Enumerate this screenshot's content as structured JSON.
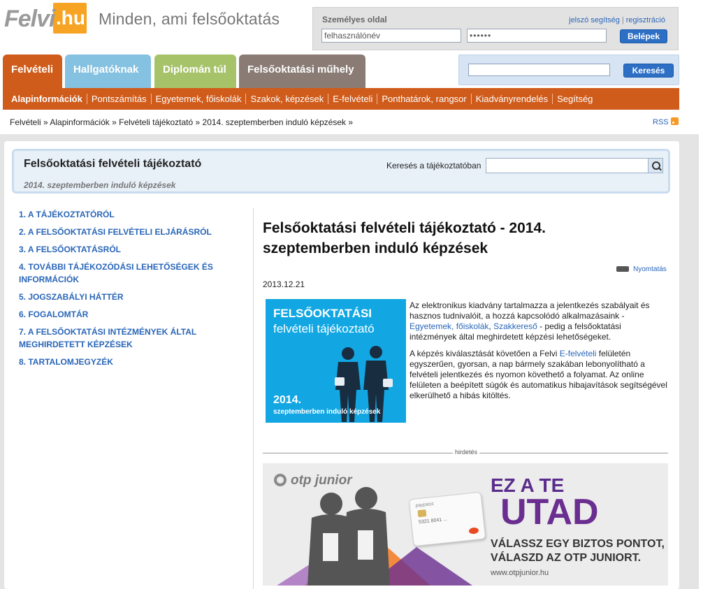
{
  "header": {
    "logo_main": "Felvi",
    "logo_accent": ".hu",
    "tagline": "Minden, ami felsőoktatás"
  },
  "login": {
    "title": "Személyes oldal",
    "forgot": "jelszó segítség",
    "register": "regisztráció",
    "separator": "|",
    "username_value": "felhasználónév",
    "password_value": "••••••",
    "submit": "Belépek"
  },
  "tabs": [
    {
      "label": "Felvételi",
      "color": "#d05c1b"
    },
    {
      "label": "Hallgatóknak",
      "color": "#85c1e0"
    },
    {
      "label": "Diplomán túl",
      "color": "#a7c36a"
    },
    {
      "label": "Felsőoktatási műhely",
      "color": "#8a7c75"
    }
  ],
  "search": {
    "value": "",
    "button": "Keresés"
  },
  "subnav": [
    "Alapinformációk",
    "Pontszámítás",
    "Egyetemek, főiskolák",
    "Szakok, képzések",
    "E-felvételi",
    "Ponthatárok, rangsor",
    "Kiadványrendelés",
    "Segítség"
  ],
  "breadcrumb": [
    "Felvételi »",
    "Alapinformációk »",
    "Felvételi tájékoztató »",
    "2014. szeptemberben induló képzések »"
  ],
  "rss": "RSS",
  "infobox": {
    "title": "Felsőoktatási felvételi tájékoztató",
    "subtitle": "2014. szeptemberben induló képzések",
    "search_label": "Keresés a tájékoztatóban",
    "search_value": ""
  },
  "toc": [
    "1. A TÁJÉKOZTATÓRÓL",
    "2. A FELSŐOKTATÁSI FELVÉTELI ELJÁRÁSRÓL",
    "3. A FELSŐOKTATÁSRÓL",
    "4. TOVÁBBI TÁJÉKOZÓDÁSI LEHETŐSÉGEK ÉS INFORMÁCIÓK",
    "5. JOGSZABÁLYI HÁTTÉR",
    "6. FOGALOMTÁR",
    "7. A FELSŐOKTATÁSI INTÉZMÉNYEK ÁLTAL MEGHIRDETETT KÉPZÉSEK",
    "8. TARTALOMJEGYZÉK"
  ],
  "article": {
    "title": "Felsőoktatási felvételi tájékoztató - 2014. szeptemberben induló képzések",
    "print": "Nyomtatás",
    "date": "2013.12.21",
    "promo": {
      "line1": "FELSŐOKTATÁSI",
      "line2": "felvételi tájékoztató",
      "year": "2014.",
      "line3": "szeptemberben induló képzések"
    },
    "p1_a": "Az elektronikus kiadvány tartalmazza a jelentkezés szabályait és hasznos tudnivalóit, a hozzá kapcsolódó alkalmazásaink - ",
    "p1_link1": "Egyetemek, főiskolák",
    "p1_comma": ", ",
    "p1_link2": "Szakkereső",
    "p1_b": " - pedig a felsőoktatási intézmények által meghirdetett képzési lehetőségeket.",
    "p2_a": "A képzés kiválasztását követően a Felvi ",
    "p2_link": "E-felvételi",
    "p2_b": " felületén egyszerűen, gyorsan, a nap bármely szakában lebonyolítható a felvételi jelentkezés és nyomon követhető a folyamat. Az online felületen a beépített súgók és automatikus hibajavítások segítségével elkerülhető a hibás kitöltés."
  },
  "ad": {
    "label": "hirdetés",
    "brand": "otp junior",
    "slogan1": "EZ A TE",
    "slogan2": "UTAD",
    "slogan3a": "VÁLASSZ EGY BIZTOS PONTOT,",
    "slogan3b": "VÁLASZD AZ OTP JUNIORT.",
    "url": "www.otpjunior.hu",
    "card_brand": "paypass",
    "card_number": "5321 8041 ...",
    "colors": {
      "purple": "#6a2e91",
      "orange": "#f47a20"
    }
  }
}
